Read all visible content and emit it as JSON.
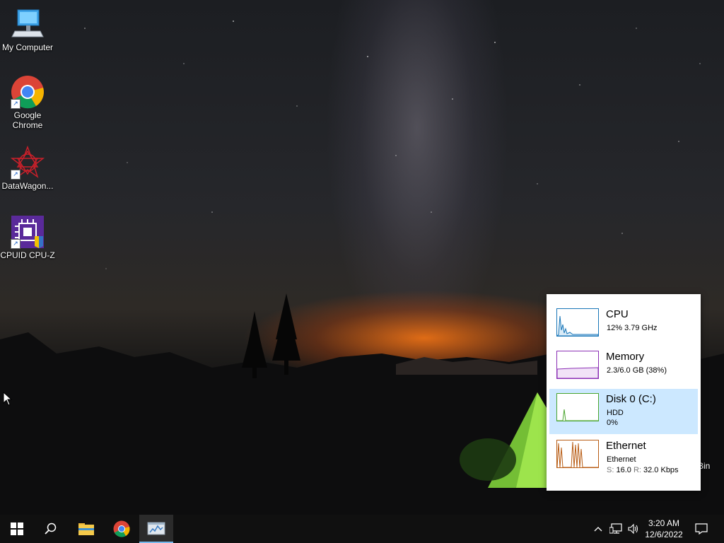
{
  "desktop": {
    "icons": [
      {
        "label": "My Computer",
        "icon": "computer-icon"
      },
      {
        "label_line1": "Google",
        "label_line2": "Chrome",
        "icon": "chrome-icon"
      },
      {
        "label": "DataWagon...",
        "icon": "datawagon-icon"
      },
      {
        "label": "CPUID CPU-Z",
        "icon": "cpuz-icon"
      }
    ],
    "partial_icon_label": "Bin"
  },
  "perf_panel": {
    "items": [
      {
        "title": "CPU",
        "line1": "12%  3.79 GHz",
        "color": "#1976b8"
      },
      {
        "title": "Memory",
        "line1": "2.3/6.0 GB (38%)",
        "color": "#8b2fb5"
      },
      {
        "title": "Disk 0 (C:)",
        "line1": "HDD",
        "line2": "0%",
        "color": "#4aa52e",
        "selected": true
      },
      {
        "title": "Ethernet",
        "line1": "Ethernet",
        "s_label": "S:",
        "s_value": "16.0",
        "r_label": "R:",
        "r_value": "32.0 Kbps",
        "color": "#b85c14"
      }
    ]
  },
  "taskbar": {
    "start": "windows-start-icon",
    "search": "search-icon",
    "pinned": [
      "file-explorer-icon",
      "chrome-icon",
      "task-manager-icon"
    ],
    "tray": {
      "chevron": "chevron-up-icon",
      "network": "network-icon",
      "volume": "volume-icon",
      "time": "3:20 AM",
      "date": "12/6/2022",
      "notifications": "notification-icon"
    },
    "accent": "#76b9ed"
  }
}
